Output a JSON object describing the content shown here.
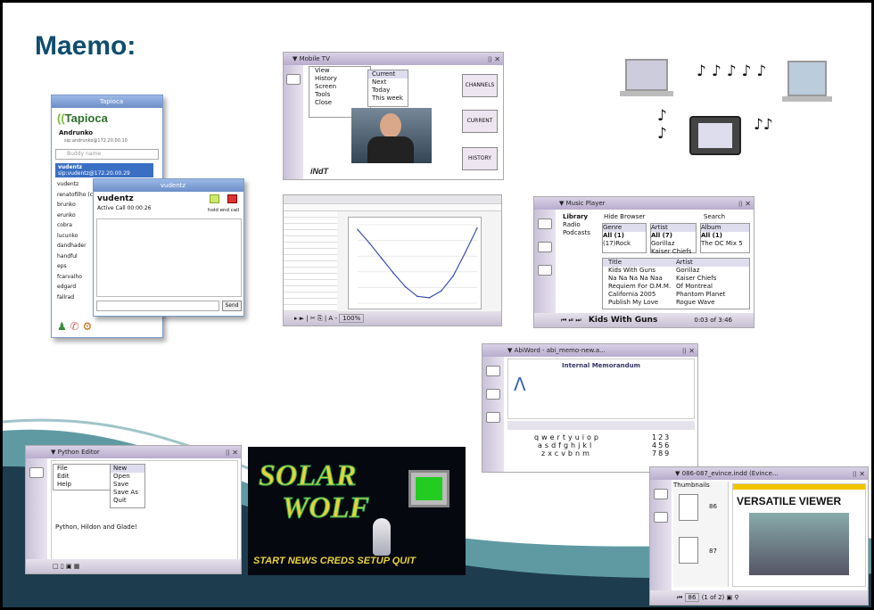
{
  "slide": {
    "title": "Maemo:"
  },
  "tapioca": {
    "window_title": "Tapioca",
    "logo": "Tapioca",
    "user_name": "Andrunko",
    "user_status": "sip:andrunko@172.20.00.10",
    "search_placeholder": "Buddy name",
    "selected_contact": "vudentz",
    "selected_contact_sub": "sip:vudentz@172.20.00.29",
    "contacts": [
      "vudentz",
      "renatofilho (co",
      "brunko",
      "erunko",
      "cobra",
      "lucunko",
      "dandhader",
      "handful",
      "eps",
      "fcarvalho",
      "edgard",
      "fallrad"
    ],
    "call_window_title": "vudentz",
    "call_name": "vudentz",
    "call_status": "Active Call 00:00:26",
    "hold_label": "hold",
    "end_call_label": "end call",
    "send_label": "Send"
  },
  "mobile_tv": {
    "window_title": "Mobile TV",
    "menu_items": [
      "View",
      "History",
      "Screen",
      "Tools",
      "Close"
    ],
    "submenu_items": [
      "Current",
      "Next",
      "Today",
      "This week"
    ],
    "buttons": [
      "CHANNELS",
      "CURRENT",
      "HISTORY"
    ],
    "logo": "iNdT"
  },
  "spreadsheet": {
    "zoom": "100%"
  },
  "chart_data": {
    "type": "line",
    "title": "",
    "xlabel": "",
    "ylabel": "",
    "x": [
      0,
      1,
      2,
      3,
      4,
      5,
      6,
      7,
      8,
      9,
      10
    ],
    "values": [
      0.98,
      0.78,
      0.56,
      0.34,
      0.14,
      0.0,
      -0.02,
      0.08,
      0.3,
      0.64,
      1.0
    ],
    "ylim": [
      -0.1,
      1.05
    ],
    "grid": true
  },
  "music": {
    "window_title": "Music Player",
    "sources": [
      "Library",
      "Radio",
      "Podcasts"
    ],
    "hide_browser": "Hide Browser",
    "search_label": "Search",
    "genre_header": "Genre",
    "genres": [
      "All (1)",
      "(17)Rock"
    ],
    "artist_header": "Artist",
    "artists": [
      "All (7)",
      "Gorillaz",
      "Kaiser Chiefs"
    ],
    "album_header": "Album",
    "albums": [
      "All (1)",
      "The OC Mix 5"
    ],
    "title_header": "Title",
    "artist_col_header": "Artist",
    "tracks": [
      {
        "title": "Kids With Guns",
        "artist": "Gorillaz"
      },
      {
        "title": "Na Na Na Na Naa",
        "artist": "Kaiser Chiefs"
      },
      {
        "title": "Requiem For O.M.M.",
        "artist": "Of Montreal"
      },
      {
        "title": "California 2005",
        "artist": "Phantom Planet"
      },
      {
        "title": "Publish My Love",
        "artist": "Rogue Wave"
      }
    ],
    "now_playing": "Kids With Guns",
    "time": "0:03 of 3:46"
  },
  "abiword": {
    "window_title": "AbiWord - abi_memo-new.a...",
    "heading": "Internal Memorandum",
    "keyboard_rows": [
      "qwertyuiop",
      "asdfghjkl",
      "zxcvbnm"
    ],
    "numpad": [
      "123",
      "456",
      "789"
    ]
  },
  "python_editor": {
    "window_title": "Python Editor",
    "menu_items": [
      "File",
      "Edit",
      "Help"
    ],
    "submenu_items": [
      "New",
      "Open",
      "Save",
      "Save As",
      "Quit"
    ],
    "body_text": "Python, Hildon and Glade!"
  },
  "solarwolf": {
    "title_line1": "SOLAR",
    "title_line2": "WOLF",
    "menu": [
      "START",
      "NEWS",
      "CREDS",
      "SETUP",
      "QUIT"
    ]
  },
  "pdf_viewer": {
    "window_title": "086-087_evince.indd (Evince...",
    "thumbnails_label": "Thumbnails",
    "page_a": "86",
    "page_b": "87",
    "headline": "VERSATILE VIEWER",
    "page_field": "86",
    "page_count": "(1 of 2)"
  },
  "colors": {
    "title": "#0f4d6e",
    "swoosh_dark": "#1d3c4d",
    "swoosh_teal": "#5f9aa3"
  }
}
